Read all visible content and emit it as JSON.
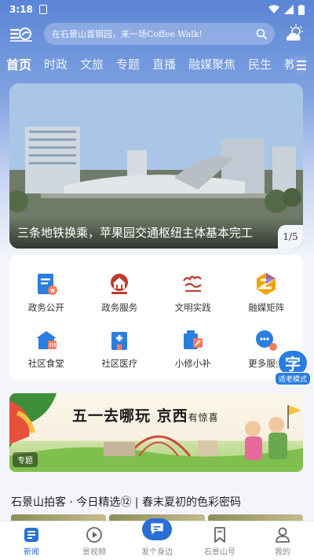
{
  "status_bar": {
    "time": "3:18"
  },
  "header": {
    "search_placeholder": "在石景山首钢园，来一场Coffee Walk!",
    "logo_icon": "shijingshan-logo-icon",
    "weather_icon": "cloudy-sun-icon"
  },
  "tabs": [
    "首页",
    "时政",
    "文旅",
    "专题",
    "直播",
    "融媒聚焦",
    "民生",
    "教"
  ],
  "active_tab": 0,
  "banner": {
    "caption": "三条地铁换乘，苹果园交通枢纽主体基本完工",
    "pager": "1/5"
  },
  "services": [
    {
      "label": "政务公开",
      "icon": "document-star-icon",
      "color": "#2a7de1"
    },
    {
      "label": "政务服务",
      "icon": "government-building-icon",
      "color": "#c0392b"
    },
    {
      "label": "文明实践",
      "icon": "civilization-practice-logo-icon",
      "color": "#c0392b"
    },
    {
      "label": "融媒矩阵",
      "icon": "media-matrix-icon",
      "color": "#f0a500"
    },
    {
      "label": "社区食堂",
      "icon": "canteen-icon",
      "color": "#2a7de1"
    },
    {
      "label": "社区医疗",
      "icon": "medical-building-icon",
      "color": "#2a7de1"
    },
    {
      "label": "小修小补",
      "icon": "repair-tools-icon",
      "color": "#2a7de1"
    },
    {
      "label": "更多服务",
      "icon": "more-services-icon",
      "color": "#2a7de1"
    }
  ],
  "elder_mode": {
    "glyph": "字",
    "label": "适老模式"
  },
  "promo": {
    "title_main": "五一去哪玩 京西",
    "title_small": "有惊喜",
    "tag": "专题"
  },
  "article": {
    "title": "石景山拍客 · 今日精选⑫ | 春末夏初的色彩密码"
  },
  "bottom_nav": [
    {
      "label": "新闻",
      "icon": "news-icon",
      "active": true
    },
    {
      "label": "景视频",
      "icon": "video-play-icon",
      "active": false
    },
    {
      "label": "发个身边",
      "icon": "post-bubble-icon",
      "active": false
    },
    {
      "label": "石景山号",
      "icon": "bookmark-icon",
      "active": false
    },
    {
      "label": "我的",
      "icon": "profile-icon",
      "active": false
    }
  ]
}
